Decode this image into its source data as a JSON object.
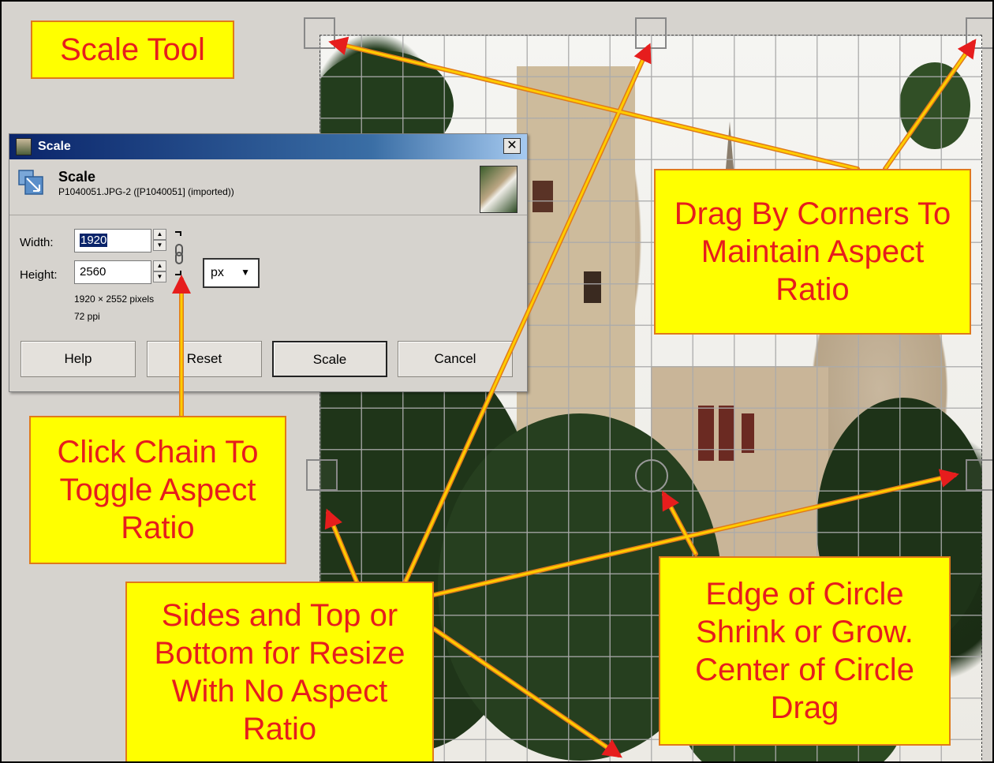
{
  "annotations": {
    "scale_tool": "Scale Tool",
    "drag_corners": "Drag By Corners To Maintain Aspect Ratio",
    "click_chain": "Click Chain To Toggle Aspect Ratio",
    "sides_top_bottom": "Sides and Top or Bottom for Resize With No Aspect Ratio",
    "edge_circle": "Edge of Circle Shrink or Grow. Center of Circle Drag"
  },
  "dialog": {
    "title": "Scale",
    "close_label": "✕",
    "header_title": "Scale",
    "header_subtitle": "P1040051.JPG-2 ([P1040051] (imported))",
    "width_label": "Width:",
    "height_label": "Height:",
    "width_value": "1920",
    "height_value": "2560",
    "unit": "px",
    "dimensions": "1920 × 2552 pixels",
    "resolution": "72 ppi",
    "buttons": {
      "help": "Help",
      "reset": "Reset",
      "scale": "Scale",
      "cancel": "Cancel"
    }
  },
  "colors": {
    "callout_bg": "#ffff00",
    "callout_text": "#e61d1d",
    "arrow_fill": "#ffcc00",
    "arrow_outline": "#e07a1a"
  }
}
